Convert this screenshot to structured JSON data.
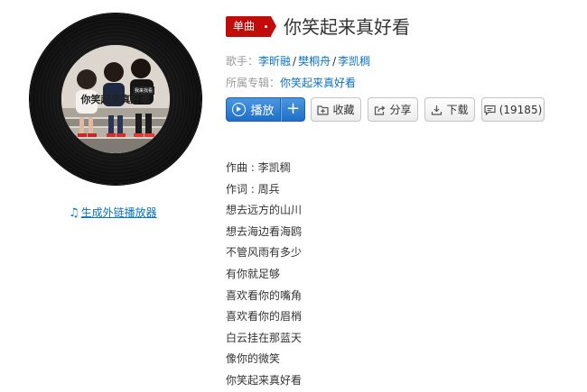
{
  "album_art": {
    "cover_text": "你笑起来真好看",
    "tag_text": "我来找看"
  },
  "player_link": {
    "label": "生成外链播放器"
  },
  "header": {
    "badge_label": "单曲",
    "title": "你笑起来真好看"
  },
  "singer": {
    "label": "歌手：",
    "names": [
      "李昕融",
      "樊桐舟",
      "李凯稠"
    ],
    "separator": "/"
  },
  "album": {
    "label": "所属专辑：",
    "name": "你笑起来真好看"
  },
  "actions": {
    "play_label": "播放",
    "add_label": "+",
    "collect_label": "收藏",
    "share_label": "分享",
    "download_label": "下载",
    "comment_count": "(19185)"
  },
  "lyrics": [
    "作曲 : 李凯稠",
    "作词 : 周兵",
    "想去远方的山川",
    "想去海边看海鸥",
    "不管风雨有多少",
    "有你就足够",
    "喜欢看你的嘴角",
    "喜欢看你的眉梢",
    "白云挂在那蓝天",
    "像你的微笑",
    "你笑起来真好看"
  ],
  "colors": {
    "accent_red": "#c20c0c",
    "link_blue": "#0c73c2",
    "play_blue": "#2b7bd0"
  }
}
